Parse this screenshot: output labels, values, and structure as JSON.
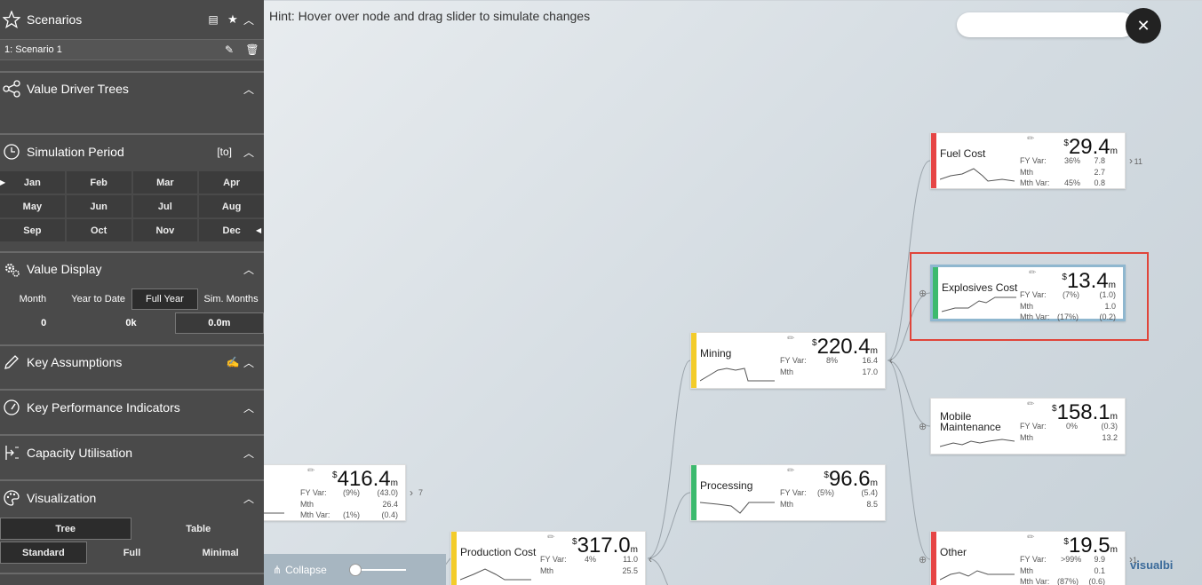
{
  "sidebar": {
    "scenarios": {
      "title": "Scenarios",
      "items": [
        {
          "label": "1: Scenario 1"
        }
      ]
    },
    "value_driver_trees": {
      "title": "Value Driver Trees"
    },
    "simulation_period": {
      "title": "Simulation Period",
      "mode": "[to]",
      "months": [
        "Jan",
        "Feb",
        "Mar",
        "Apr",
        "May",
        "Jun",
        "Jul",
        "Aug",
        "Sep",
        "Oct",
        "Nov",
        "Dec"
      ]
    },
    "value_display": {
      "title": "Value Display",
      "options": [
        "Month",
        "Year to Date",
        "Full Year",
        "Sim. Months"
      ],
      "selected": "Full Year",
      "values": [
        "0",
        "0k",
        "0.0m"
      ]
    },
    "key_assumptions": {
      "title": "Key Assumptions"
    },
    "kpi": {
      "title": "Key Performance Indicators"
    },
    "capacity": {
      "title": "Capacity Utilisation"
    },
    "visualization": {
      "title": "Visualization",
      "view_options": [
        "Tree",
        "Table"
      ],
      "selected_view": "Tree",
      "density_options": [
        "Standard",
        "Full",
        "Minimal"
      ],
      "selected_density": "Standard"
    }
  },
  "canvas": {
    "hint": "Hint: Hover over node and drag slider to simulate changes",
    "search_value": "",
    "collapse_label": "Collapse",
    "logo_text": "visualbi",
    "nodes": {
      "root": {
        "name": "",
        "currency": "$",
        "value": "416.4",
        "unit": "m",
        "fy_var_label": "FY Var:",
        "fy_var_pct": "(9%)",
        "fy_var_val": "(43.0)",
        "mth_label": "Mth",
        "mth_val": "26.4",
        "mth_var_label": "Mth Var:",
        "mth_var_pct": "(1%)",
        "mth_var_val": "(0.4)",
        "count": "7"
      },
      "production": {
        "name": "Production Cost",
        "currency": "$",
        "value": "317.0",
        "unit": "m",
        "fy_var_label": "FY Var:",
        "fy_var_pct": "4%",
        "fy_var_val": "11.0",
        "mth_label": "Mth",
        "mth_val": "25.5"
      },
      "mining": {
        "name": "Mining",
        "currency": "$",
        "value": "220.4",
        "unit": "m",
        "fy_var_label": "FY Var:",
        "fy_var_pct": "8%",
        "fy_var_val": "16.4",
        "mth_label": "Mth",
        "mth_val": "17.0"
      },
      "processing": {
        "name": "Processing",
        "currency": "$",
        "value": "96.6",
        "unit": "m",
        "fy_var_label": "FY Var:",
        "fy_var_pct": "(5%)",
        "fy_var_val": "(5.4)",
        "mth_label": "Mth",
        "mth_val": "8.5"
      },
      "fuel": {
        "name": "Fuel Cost",
        "currency": "$",
        "value": "29.4",
        "unit": "m",
        "fy_var_label": "FY Var:",
        "fy_var_pct": "36%",
        "fy_var_val": "7.8",
        "mth_label": "Mth",
        "mth_val": "2.7",
        "mth_var_label": "Mth Var:",
        "mth_var_pct": "45%",
        "mth_var_val": "0.8",
        "count": "11"
      },
      "explosives": {
        "name": "Explosives Cost",
        "currency": "$",
        "value": "13.4",
        "unit": "m",
        "fy_var_label": "FY Var:",
        "fy_var_pct": "(7%)",
        "fy_var_val": "(1.0)",
        "mth_label": "Mth",
        "mth_val": "1.0",
        "mth_var_label": "Mth Var:",
        "mth_var_pct": "(17%)",
        "mth_var_val": "(0.2)"
      },
      "mobile": {
        "name_1": "Mobile",
        "name_2": "Maintenance",
        "currency": "$",
        "value": "158.1",
        "unit": "m",
        "fy_var_label": "FY Var:",
        "fy_var_pct": "0%",
        "fy_var_val": "(0.3)",
        "mth_label": "Mth",
        "mth_val": "13.2"
      },
      "other": {
        "name": "Other",
        "currency": "$",
        "value": "19.5",
        "unit": "m",
        "fy_var_label": "FY Var:",
        "fy_var_pct": ">99%",
        "fy_var_val": "9.9",
        "mth_label": "Mth",
        "mth_val": "0.1",
        "mth_var_label": "Mth Var:",
        "mth_var_pct": "(87%)",
        "mth_var_val": "(0.6)",
        "count": "1"
      }
    }
  },
  "colors": {
    "sidebar": "#4a4a4a",
    "red": "#e64545",
    "green": "#3cba6e",
    "yellow": "#f3cc2a",
    "highlight": "#e0453a"
  }
}
